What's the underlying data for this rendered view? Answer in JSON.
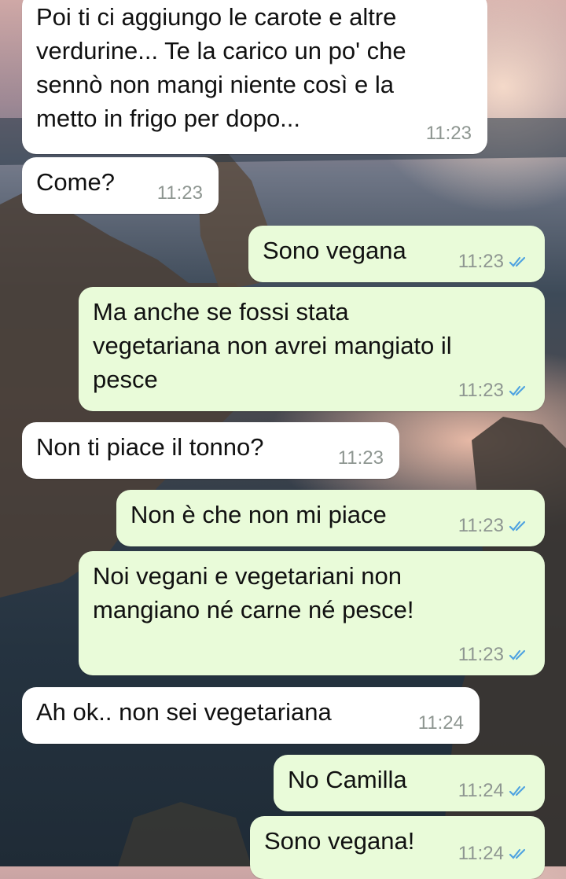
{
  "messages": [
    {
      "dir": "in",
      "text": "Poi ti ci aggiungo le carote e altre\nverdurine... Te la carico un po' che\nsennò non mangi niente così e la\nmetto in frigo per dopo...",
      "time": "11:23"
    },
    {
      "dir": "in",
      "text": "Come?",
      "time": "11:23"
    },
    {
      "dir": "out",
      "text": "Sono vegana",
      "time": "11:23"
    },
    {
      "dir": "out",
      "text": "Ma anche se fossi stata\nvegetariana non avrei mangiato il\npesce",
      "time": "11:23"
    },
    {
      "dir": "in",
      "text": "Non ti piace il tonno?",
      "time": "11:23"
    },
    {
      "dir": "out",
      "text": "Non è che non mi piace",
      "time": "11:23"
    },
    {
      "dir": "out",
      "text": "Noi vegani e vegetariani non\nmangiano né carne né pesce!",
      "time": "11:23"
    },
    {
      "dir": "in",
      "text": "Ah ok.. non sei vegetariana",
      "time": "11:24"
    },
    {
      "dir": "out",
      "text": "No Camilla",
      "time": "11:24"
    },
    {
      "dir": "out",
      "text": "Sono vegana!",
      "time": "11:24"
    }
  ],
  "colors": {
    "incoming": "#ffffff",
    "outgoing": "#e9fbd9",
    "read_ticks": "#4fa3e0",
    "timestamp": "#8e9691"
  },
  "icons": {
    "read_receipt": "double-check-icon",
    "background": "coastal-cliffs-sunset-wallpaper"
  }
}
